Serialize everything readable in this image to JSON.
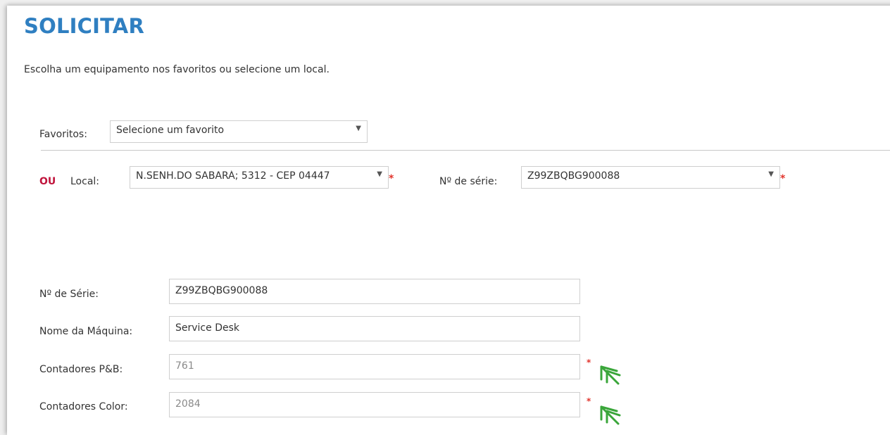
{
  "page": {
    "title": "SOLICITAR",
    "subtitle": "Escolha um equipamento nos favoritos ou selecione um local."
  },
  "favorites": {
    "label": "Favoritos:",
    "selected": "Selecione um favorito"
  },
  "location_row": {
    "or_label": "OU",
    "local_label": "Local:",
    "local_selected": "N.SENH.DO SABARÁ; 5312 - CEP 04447",
    "serial_label": "Nº de série:",
    "serial_selected": "Z99ZBQBG900088",
    "required_mark": "*"
  },
  "details": {
    "serial": {
      "label": "Nº de Série:",
      "value": "Z99ZBQBG900088"
    },
    "machine_name": {
      "label": "Nome da Máquina:",
      "value": "Service Desk"
    },
    "counter_bw": {
      "label": "Contadores P&B:",
      "value": "761",
      "required_mark": "*"
    },
    "counter_color": {
      "label": "Contadores Color:",
      "value": "2084",
      "required_mark": "*"
    }
  },
  "icons": {
    "dropdown_caret": "chevron-down-icon",
    "annotation_arrow": "double-arrow-up-left-icon"
  },
  "colors": {
    "title_blue": "#2f7fc1",
    "or_red": "#c0143c",
    "required_red": "#e2342c",
    "arrow_green": "#3aa63a"
  }
}
